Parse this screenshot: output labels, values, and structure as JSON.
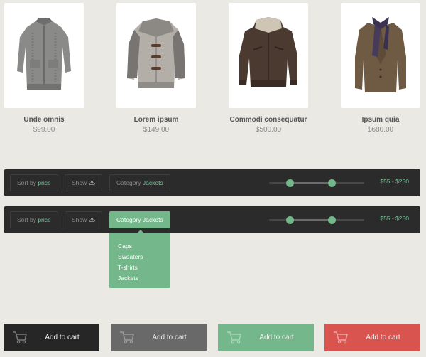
{
  "products": [
    {
      "name": "Unde omnis",
      "price": "$99.00",
      "image": "knit-cardigan"
    },
    {
      "name": "Lorem ipsum",
      "price": "$149.00",
      "image": "duffle-jacket"
    },
    {
      "name": "Commodi consequatur",
      "price": "$500.00",
      "image": "leather-jacket"
    },
    {
      "name": "Ipsum quia",
      "price": "$680.00",
      "image": "tweed-blazer-scarf"
    }
  ],
  "filter_bars": [
    {
      "sort_prefix": "Sort by",
      "sort_value": "price",
      "show_prefix": "Show",
      "show_value": "25",
      "category_prefix": "Category",
      "category_value": "Jackets",
      "category_open": false,
      "price_range": "$55 - $250",
      "slider_min_fraction": 0.22,
      "slider_max_fraction": 0.66
    },
    {
      "sort_prefix": "Sort by",
      "sort_value": "price",
      "show_prefix": "Show",
      "show_value": "25",
      "category_prefix": "Category",
      "category_value": "Jackets",
      "category_open": true,
      "price_range": "$55 - $250",
      "slider_min_fraction": 0.22,
      "slider_max_fraction": 0.66
    }
  ],
  "dropdown": {
    "items": [
      "Caps",
      "Sweaters",
      "T-shirts",
      "Jackets"
    ]
  },
  "cart_buttons": [
    {
      "label": "Add to cart",
      "color": "#262626"
    },
    {
      "label": "Add to cart",
      "color": "#696969"
    },
    {
      "label": "Add to cart",
      "color": "#73b78a"
    },
    {
      "label": "Add to cart",
      "color": "#d9534f"
    }
  ],
  "colors": {
    "accent": "#73b78a",
    "bar": "#2b2b2b",
    "background": "#ebe9e4"
  }
}
